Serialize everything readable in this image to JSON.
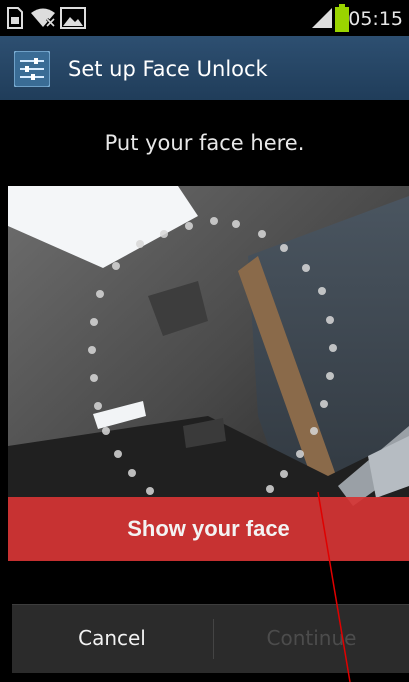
{
  "status_bar": {
    "time": "05:15",
    "icons": [
      "sim-icon",
      "wifi-icon",
      "image-notification-icon",
      "signal-icon",
      "battery-icon"
    ]
  },
  "action_bar": {
    "title": "Set up Face Unlock",
    "icon": "settings-sliders-icon"
  },
  "instruction": "Put your face here.",
  "camera": {
    "banner_text": "Show your face"
  },
  "buttons": {
    "cancel": "Cancel",
    "continue": "Continue"
  },
  "colors": {
    "action_bar": "#2a4a6b",
    "banner": "#d63434",
    "battery": "#9ad400"
  }
}
